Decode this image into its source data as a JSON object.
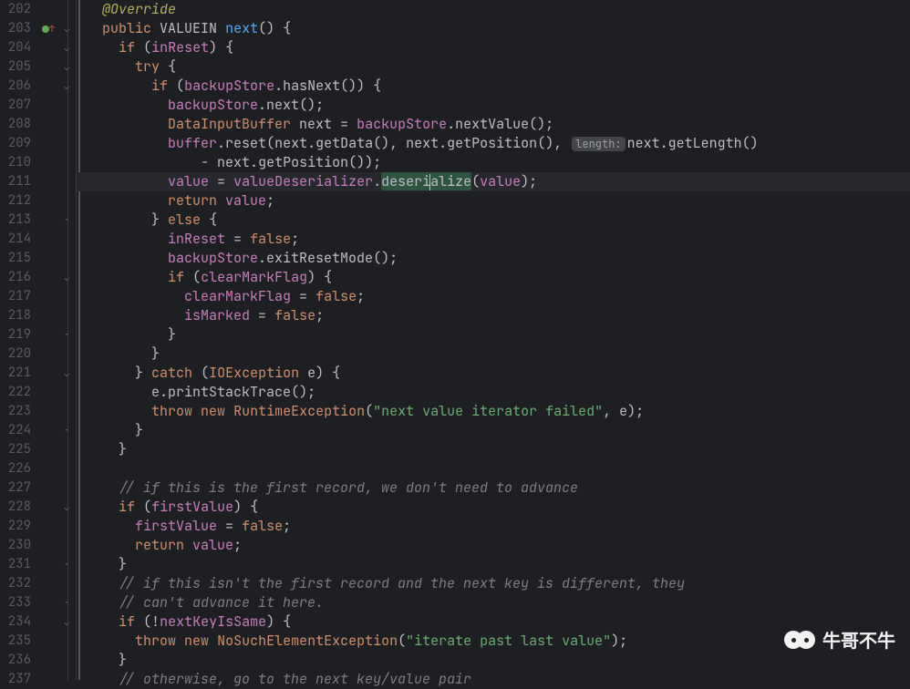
{
  "lines": {
    "start": 202,
    "end": 237
  },
  "gutter_markers": {
    "203": "modified"
  },
  "annotation_line": "@Override",
  "tokens": {
    "public": "public",
    "valuein": "VALUEIN",
    "next": "next",
    "if": "if",
    "inReset": "inReset",
    "try": "try",
    "backupStore": "backupStore",
    "hasNext": "hasNext",
    "nextMethod": "next",
    "DataInputBuffer": "DataInputBuffer",
    "nextVar": "next",
    "nextValue": "nextValue",
    "buffer": "buffer",
    "reset": "reset",
    "getData": "getData",
    "getPosition": "getPosition",
    "paramHint": "length:",
    "getLength": "getLength",
    "minus": "- ",
    "value": "value",
    "valueDeserializer": "valueDeserializer",
    "deserialize": "deserialize",
    "return": "return",
    "else": "else",
    "false": "false",
    "exitResetMode": "exitResetMode",
    "clearMarkFlag": "clearMarkFlag",
    "isMarked": "isMarked",
    "catch": "catch",
    "IOException": "IOException",
    "e": "e",
    "printStackTrace": "printStackTrace",
    "throw": "throw",
    "new": "new",
    "RuntimeException": "RuntimeException",
    "str1": "\"next value iterator failed\"",
    "cmt1": "// if this is the first record, we don't need to advance",
    "firstValue": "firstValue",
    "cmt2": "// if this isn't the first record and the next key is different, they",
    "cmt3": "// can't advance it here.",
    "nextKeyIsSame": "nextKeyIsSame",
    "NoSuchElementException": "NoSuchElementException",
    "str2": "\"iterate past last value\"",
    "cmt4": "// otherwise, go to the next key/value pair"
  },
  "watermark": "牛哥不牛",
  "current_line": 211,
  "fold_markers": {
    "203": "open-down",
    "204": "open-down",
    "205": "open-down",
    "206": "open-down",
    "213": "close-up",
    "216": "open-down",
    "219": "close-up",
    "221": "open-down",
    "224": "close-up",
    "228": "open-down",
    "231": "close-up",
    "233": "close-up",
    "234": "open-down"
  }
}
